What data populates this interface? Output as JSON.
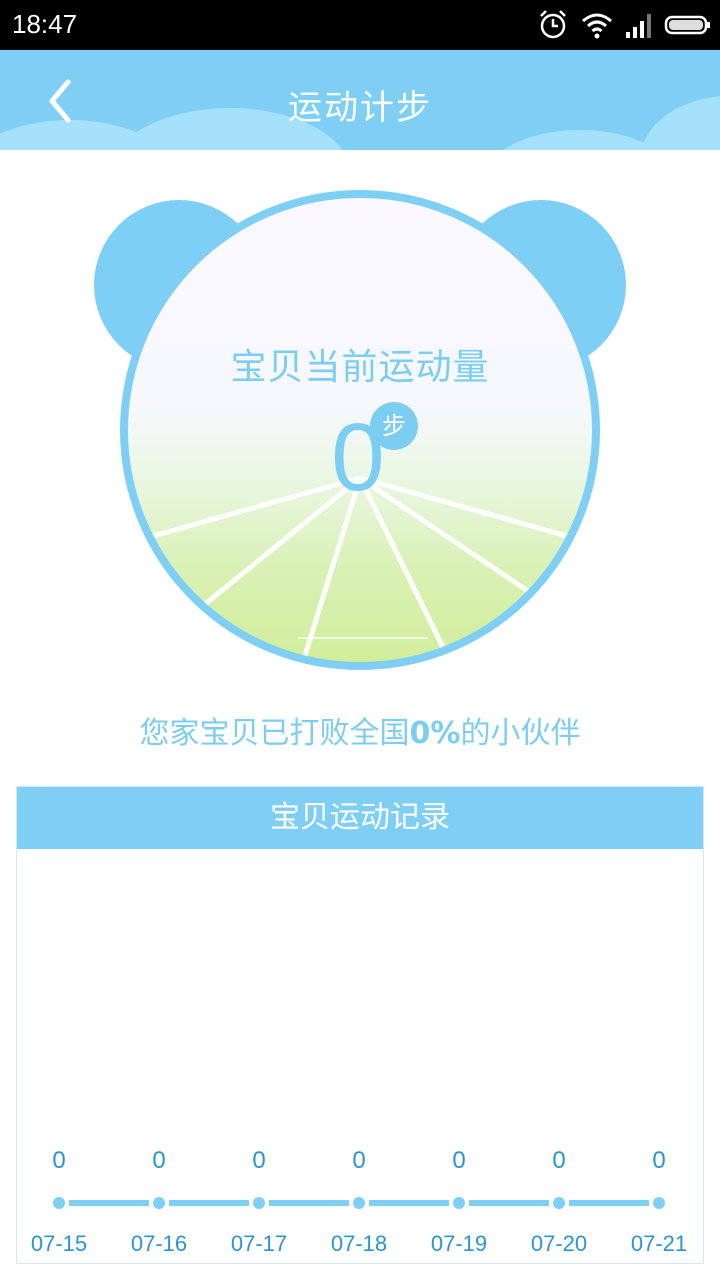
{
  "status_bar": {
    "time": "18:47",
    "icons": [
      "alarm-icon",
      "wifi-icon",
      "signal-icon",
      "battery-icon"
    ]
  },
  "header": {
    "title": "运动计步",
    "back_icon": "chevron-left-icon"
  },
  "pedometer": {
    "label": "宝贝当前运动量",
    "steps": "0",
    "unit": "步"
  },
  "ranking": {
    "prefix": "您家宝贝已打败全国",
    "percent": "0%",
    "suffix": "的小伙伴"
  },
  "record": {
    "title": "宝贝运动记录",
    "values": [
      "0",
      "0",
      "0",
      "0",
      "0",
      "0",
      "0"
    ],
    "dates": [
      "07-15",
      "07-16",
      "07-17",
      "07-18",
      "07-19",
      "07-20",
      "07-21"
    ]
  },
  "colors": {
    "accent": "#7fcff5",
    "text_blue": "#7ccdf2",
    "axis_text": "#2a95d4"
  }
}
